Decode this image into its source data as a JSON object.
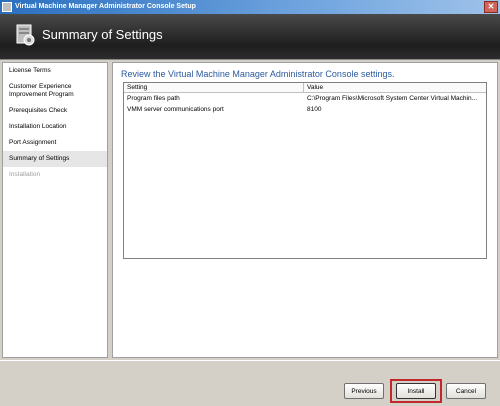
{
  "window": {
    "title": "Virtual Machine Manager Administrator Console Setup",
    "close_glyph": "✕"
  },
  "banner": {
    "heading": "Summary of Settings"
  },
  "nav": {
    "items": [
      {
        "label": "License Terms",
        "state": "normal"
      },
      {
        "label": "Customer Experience Improvement Program",
        "state": "normal"
      },
      {
        "label": "Prerequisites Check",
        "state": "normal"
      },
      {
        "label": "Installation Location",
        "state": "normal"
      },
      {
        "label": "Port Assignment",
        "state": "normal"
      },
      {
        "label": "Summary of Settings",
        "state": "active"
      },
      {
        "label": "Installation",
        "state": "disabled"
      }
    ]
  },
  "main": {
    "review_text": "Review the Virtual Machine Manager Administrator Console settings.",
    "table": {
      "headers": [
        "Setting",
        "Value"
      ],
      "rows": [
        [
          "Program files path",
          "C:\\Program Files\\Microsoft System Center Virtual Machin..."
        ],
        [
          "VMM server communications port",
          "8100"
        ]
      ]
    }
  },
  "buttons": {
    "previous": "Previous",
    "install": "Install",
    "cancel": "Cancel"
  },
  "colors": {
    "accent_text": "#2b5a9c",
    "highlight": "#c0282a"
  }
}
